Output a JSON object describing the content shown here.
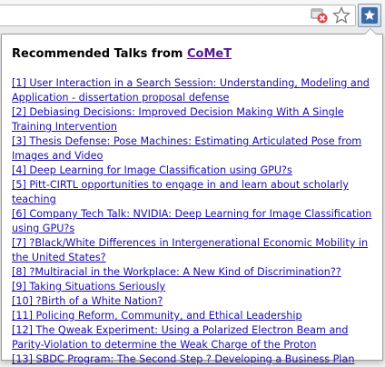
{
  "popup": {
    "title_prefix": "Recommended Talks from ",
    "title_link": "CoMeT",
    "talks": [
      "[1] User Interaction in a Search Session: Understanding, Modeling and Application - dissertation proposal defense",
      "[2] Debiasing Decisions: Improved Decision Making With A Single Training Intervention",
      "[3] Thesis Defense: Pose Machines: Estimating Articulated Pose from Images and Video",
      "[4] Deep Learning for Image Classification using GPU?s",
      "[5] Pitt-CIRTL opportunities to engage in and learn about scholarly teaching",
      "[6] Company Tech Talk: NVIDIA: Deep Learning for Image Classification using GPU?s",
      "[7] ?Black/White Differences in Intergenerational Economic Mobility in the United States?",
      "[8] ?Multiracial in the Workplace: A New Kind of Discrimination??",
      "[9] Taking Situations Seriously",
      "[10] ?Birth of a White Nation?",
      "[11] Policing Reform, Community, and Ethical Leadership",
      "[12] The Qweak Experiment: Using a Polarized Electron Beam and Parity-Violation to determine the Weak Charge of the Proton",
      "[13] SBDC Program: The Second Step ? Developing a Business Plan"
    ]
  },
  "toolbar": {
    "icons": [
      "popup-blocked-icon",
      "bookmark-star-icon",
      "extension-icon"
    ]
  },
  "colors": {
    "link": "#1a0dab",
    "visited_link": "#551a8b"
  }
}
